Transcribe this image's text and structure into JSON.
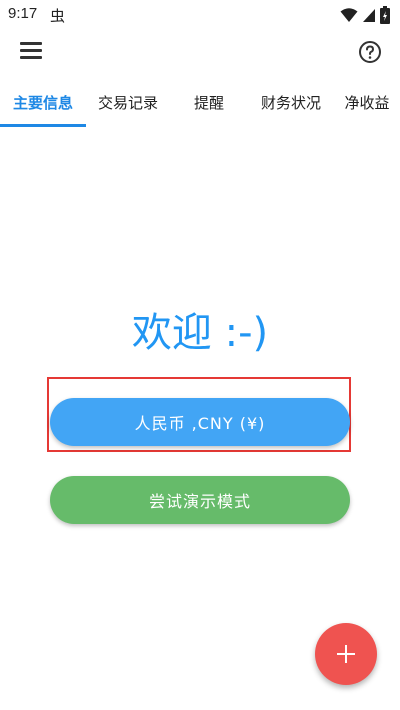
{
  "status_bar": {
    "time": "9:17",
    "app_icon_glyph": "虫",
    "icons": [
      "wifi-icon",
      "signal-icon",
      "battery-icon"
    ]
  },
  "toolbar": {
    "menu_icon": "menu-icon",
    "help_icon": "help-icon"
  },
  "tabs": [
    {
      "label": "主要信息",
      "active": true
    },
    {
      "label": "交易记录",
      "active": false
    },
    {
      "label": "提醒",
      "active": false
    },
    {
      "label": "财务状况",
      "active": false
    },
    {
      "label": "净收益",
      "active": false
    }
  ],
  "main": {
    "welcome_text": "欢迎 :-)",
    "currency_button_label": "人民币 ,CNY (¥)",
    "demo_button_label": "尝试演示模式"
  },
  "fab": {
    "icon": "plus-icon"
  },
  "colors": {
    "accent": "#1e88e5",
    "currency_button": "#42a5f5",
    "demo_button": "#66bb6a",
    "fab": "#ef5350",
    "highlight": "#e53935"
  }
}
